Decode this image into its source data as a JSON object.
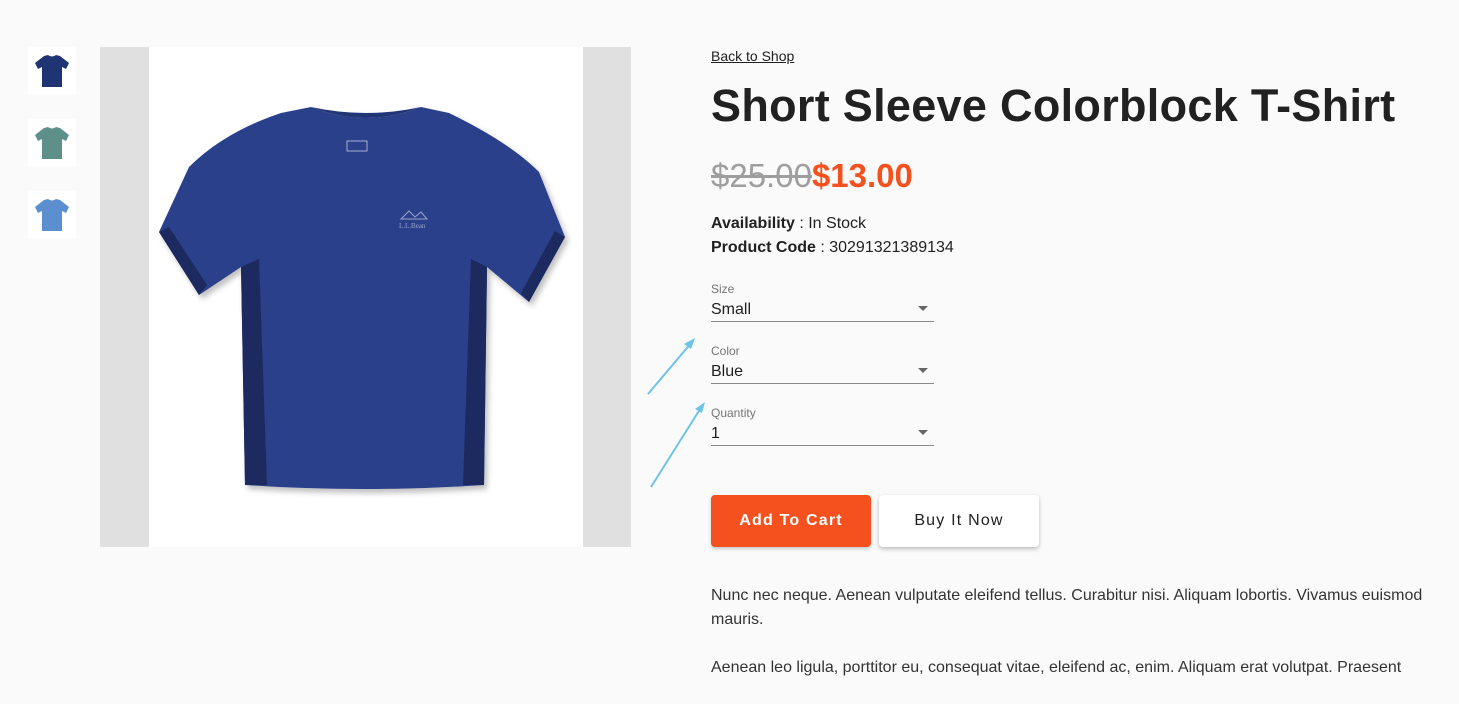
{
  "nav": {
    "back_label": "Back to Shop"
  },
  "product": {
    "title": "Short Sleeve Colorblock T-Shirt",
    "price_original": "$25.00",
    "price_sale": "$13.00",
    "availability_label": "Availability",
    "availability_value": "In Stock",
    "code_label": "Product Code",
    "code_value": "30291321389134",
    "brand_logo_text": "L.L.Bean"
  },
  "gallery": {
    "thumbnails": [
      {
        "name": "navy",
        "color": "#1f3473"
      },
      {
        "name": "teal",
        "color": "#5f8f89"
      },
      {
        "name": "light-blue",
        "color": "#5b8fcf"
      }
    ],
    "main_color": "#2c3f8a",
    "main_side_panel_color": "#1a2a5e"
  },
  "options": {
    "size": {
      "label": "Size",
      "value": "Small"
    },
    "color": {
      "label": "Color",
      "value": "Blue"
    },
    "quantity": {
      "label": "Quantity",
      "value": "1"
    }
  },
  "actions": {
    "add_to_cart": "Add To Cart",
    "buy_now": "Buy It Now"
  },
  "description": {
    "p1": "Nunc nec neque. Aenean vulputate eleifend tellus. Curabitur nisi. Aliquam lobortis. Vivamus euismod mauris.",
    "p2": "Aenean leo ligula, porttitor eu, consequat vitae, eleifend ac, enim. Aliquam erat volutpat. Praesent"
  },
  "colors": {
    "accent": "#f4511e",
    "annotation_arrow": "#6ec3e6"
  }
}
